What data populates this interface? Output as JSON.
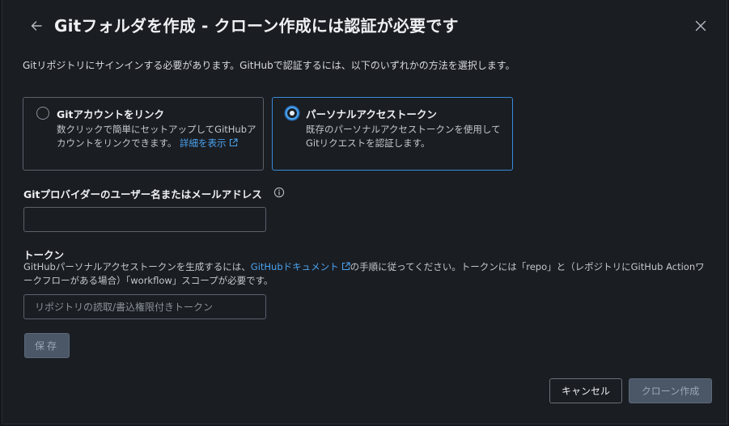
{
  "dialog": {
    "title": "Gitフォルダを作成 - クローン作成には認証が必要です",
    "intro": "Gitリポジトリにサインインする必要があります。GitHubで認証するには、以下のいずれかの方法を選択します。"
  },
  "auth_options": [
    {
      "title": "Gitアカウントをリンク",
      "description": "数クリックで簡単にセットアップしてGitHubアカウントをリンクできます。",
      "link_label": "詳細を表示",
      "selected": false
    },
    {
      "title": "パーソナルアクセストークン",
      "description": "既存のパーソナルアクセストークンを使用してGitリクエストを認証します。",
      "selected": true
    }
  ],
  "username_field": {
    "label": "Gitプロバイダーのユーザー名またはメールアドレス",
    "value": "",
    "placeholder": ""
  },
  "token_field": {
    "label": "トークン",
    "description_before": "GitHubパーソナルアクセストークンを生成するには、",
    "doc_link": "GitHubドキュメント",
    "description_after": "の手順に従ってください。トークンには「repo」と（レポジトリにGitHub Actionワークフローがある場合）「workflow」スコープが必要です。",
    "value": "",
    "placeholder": "リポジトリの読取/書込権限付きトークン"
  },
  "buttons": {
    "save": "保存",
    "cancel": "キャンセル",
    "clone": "クローン作成"
  },
  "colors": {
    "background": "#1a1d22",
    "accent": "#4aa3f0",
    "selected_border": "#3a8ad8",
    "disabled_button": "#4b5766"
  }
}
